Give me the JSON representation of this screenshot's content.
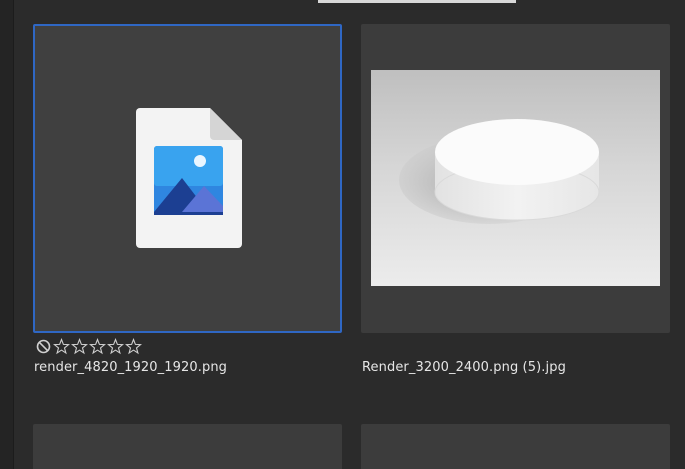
{
  "grid": {
    "items": [
      {
        "filename": "render_4820_1920_1920.png",
        "selected": true,
        "thumbnail": "generic-image-file-icon",
        "rating": 0,
        "rating_max": 5,
        "rejected_flag_visible": true
      },
      {
        "filename": "Render_3200_2400.png (5).jpg",
        "selected": false,
        "thumbnail": "white-cylinder-render-preview"
      },
      {
        "filename": "",
        "selected": false,
        "thumbnail": ""
      },
      {
        "filename": "",
        "selected": false,
        "thumbnail": ""
      }
    ]
  },
  "colors": {
    "background": "#2b2b2b",
    "tile": "#3c3c3c",
    "selection_border": "#2f67c4",
    "text": "#e6e6e6"
  }
}
